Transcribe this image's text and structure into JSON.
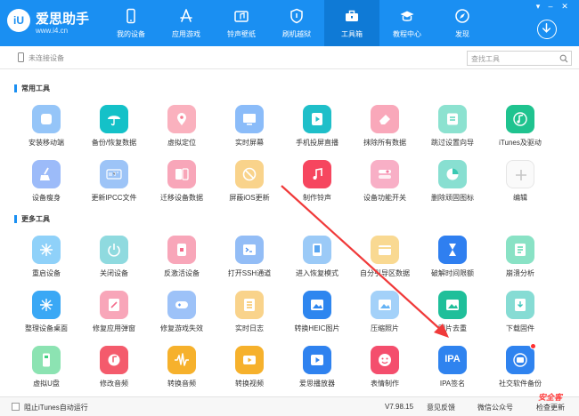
{
  "app": {
    "logo_mark": "iU",
    "name": "爱思助手",
    "url": "www.i4.cn"
  },
  "nav": [
    {
      "label": "我的设备",
      "icon": "phone-icon"
    },
    {
      "label": "应用游戏",
      "icon": "app-store-icon"
    },
    {
      "label": "铃声壁纸",
      "icon": "music-icon"
    },
    {
      "label": "刷机越狱",
      "icon": "shield-icon"
    },
    {
      "label": "工具箱",
      "icon": "toolbox-icon",
      "active": true
    },
    {
      "label": "教程中心",
      "icon": "graduation-cap-icon"
    },
    {
      "label": "发现",
      "icon": "compass-icon"
    }
  ],
  "device_status": "未连接设备",
  "search": {
    "placeholder": "查找工具",
    "value": ""
  },
  "sections": {
    "common": "常用工具",
    "more": "更多工具"
  },
  "common_tools": [
    {
      "label": "安装移动端",
      "icon": "iu-app-icon",
      "color": "#4f9ff3",
      "light": true
    },
    {
      "label": "备份/恢复数据",
      "icon": "umbrella-icon",
      "color": "#14c1c8"
    },
    {
      "label": "虚拟定位",
      "icon": "location-pin-icon",
      "color": "#f77d92",
      "light": true
    },
    {
      "label": "实时屏幕",
      "icon": "screen-icon",
      "color": "#3d8ff5",
      "light": true
    },
    {
      "label": "手机投屏直播",
      "icon": "play-icon",
      "color": "#1fbfc9"
    },
    {
      "label": "抹除所有数据",
      "icon": "eraser-icon",
      "color": "#f56e8c",
      "light": true
    },
    {
      "label": "跳过设置向导",
      "icon": "skip-icon",
      "color": "#3fcfb0",
      "light": true
    },
    {
      "label": "iTunes及驱动",
      "icon": "music-note-icon",
      "color": "#1fc38f"
    },
    {
      "label": "设备瘦身",
      "icon": "broom-icon",
      "color": "#5a8ef5",
      "light": true
    },
    {
      "label": "更新IPCC文件",
      "icon": "ipcc-icon",
      "color": "#5b9cf2",
      "light": true
    },
    {
      "label": "迁移设备数据",
      "icon": "migrate-icon",
      "color": "#f46a8a",
      "light": true
    },
    {
      "label": "屏蔽iOS更新",
      "icon": "block-icon",
      "color": "#f5b63d",
      "light": true
    },
    {
      "label": "制作铃声",
      "icon": "bell-note-icon",
      "color": "#f6465f"
    },
    {
      "label": "设备功能开关",
      "icon": "toggle-icon",
      "color": "#f47aa0",
      "light": true
    },
    {
      "label": "删除顽固图标",
      "icon": "pie-icon",
      "color": "#39c9b3",
      "light": true
    },
    {
      "label": "编辑",
      "icon": "plus-icon",
      "color": "#eeeeee",
      "light": true
    }
  ],
  "more_tools": [
    {
      "label": "重启设备",
      "icon": "restart-icon",
      "color": "#45b3f5",
      "light": true
    },
    {
      "label": "关闭设备",
      "icon": "power-icon",
      "color": "#44c1c9",
      "light": true
    },
    {
      "label": "反激活设备",
      "icon": "phone-lock-icon",
      "color": "#f46a8a",
      "light": true
    },
    {
      "label": "打开SSH通道",
      "icon": "terminal-icon",
      "color": "#4b91f0",
      "light": true
    },
    {
      "label": "进入恢复模式",
      "icon": "recovery-icon",
      "color": "#59a6f1",
      "light": true
    },
    {
      "label": "自分引导区数据",
      "icon": "sector-icon",
      "color": "#f5c04a",
      "light": true
    },
    {
      "label": "破解时间限额",
      "icon": "hourglass-icon",
      "color": "#2f7ff0"
    },
    {
      "label": "崩溃分析",
      "icon": "report-icon",
      "color": "#3bcf9e",
      "light": true
    },
    {
      "label": "整理设备桌面",
      "icon": "grid-icon",
      "color": "#3aa8f5"
    },
    {
      "label": "修复应用弹窗",
      "icon": "repair-icon",
      "color": "#f46a8a",
      "light": true
    },
    {
      "label": "修复游戏失效",
      "icon": "gamepad-icon",
      "color": "#5b9af4",
      "light": true
    },
    {
      "label": "实时日志",
      "icon": "log-icon",
      "color": "#f5b63d",
      "light": true
    },
    {
      "label": "转换HEIC图片",
      "icon": "image-convert-icon",
      "color": "#2e86ef"
    },
    {
      "label": "压缩照片",
      "icon": "photo-icon",
      "color": "#66b3f5",
      "light": true
    },
    {
      "label": "图片去重",
      "icon": "image-dedupe-icon",
      "color": "#1fbf9a"
    },
    {
      "label": "下载固件",
      "icon": "firmware-icon",
      "color": "#36c4b8",
      "light": true
    },
    {
      "label": "虚拟U盘",
      "icon": "usb-icon",
      "color": "#3fd07e",
      "light": true
    },
    {
      "label": "修改音频",
      "icon": "audio-edit-icon",
      "color": "#f45b6c"
    },
    {
      "label": "转换音频",
      "icon": "waveform-icon",
      "color": "#f6b12c"
    },
    {
      "label": "转换视频",
      "icon": "video-icon",
      "color": "#f6b12c"
    },
    {
      "label": "爱思播放器",
      "icon": "player-icon",
      "color": "#2f82ef"
    },
    {
      "label": "表情制作",
      "icon": "emoji-icon",
      "color": "#f44e6d"
    },
    {
      "label": "IPA签名",
      "icon": "ipa-icon",
      "color": "#2f83ef",
      "text": "IPA"
    },
    {
      "label": "社交软件备份",
      "icon": "chat-backup-icon",
      "color": "#2f83ef",
      "badge": true
    }
  ],
  "footer": {
    "itunes_checkbox_label": "阻止iTunes自动运行",
    "version": "V7.98.15",
    "feedback": "意见反馈",
    "wechat": "微信公众号",
    "check_update": "检查更新"
  },
  "watermark": "安全客"
}
